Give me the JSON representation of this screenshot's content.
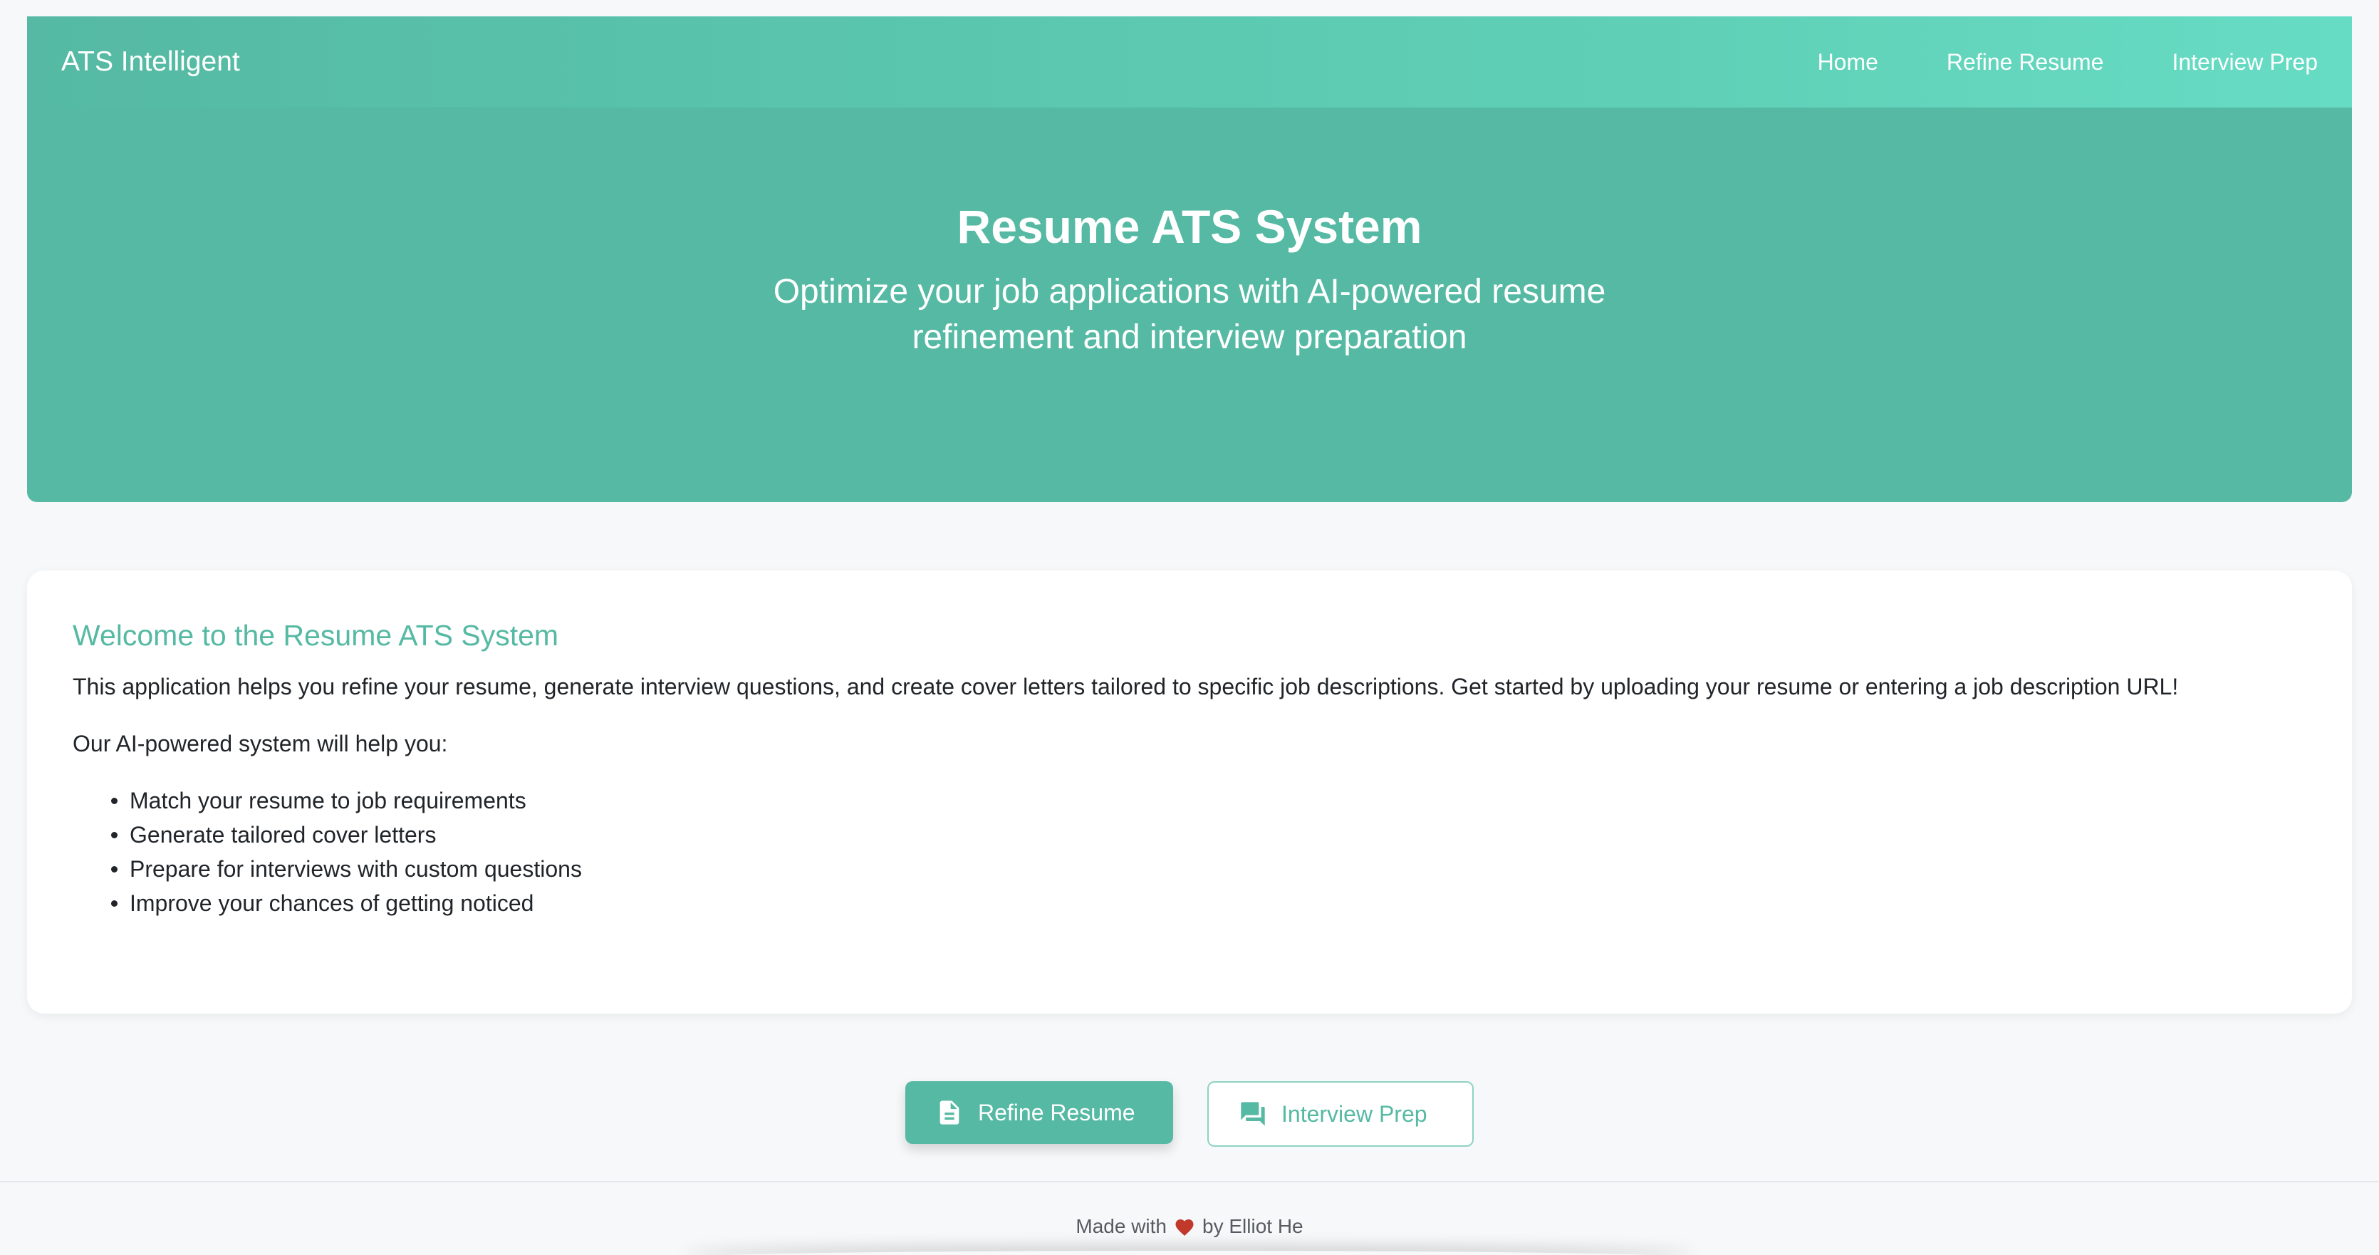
{
  "navbar": {
    "brand": "ATS Intelligent",
    "links": [
      {
        "label": "Home"
      },
      {
        "label": "Refine Resume"
      },
      {
        "label": "Interview Prep"
      }
    ]
  },
  "hero": {
    "title": "Resume ATS System",
    "subtitle": "Optimize your job applications with AI-powered resume refinement and interview preparation"
  },
  "welcome": {
    "title": "Welcome to the Resume ATS System",
    "intro": "This application helps you refine your resume, generate interview questions, and create cover letters tailored to specific job descriptions. Get started by uploading your resume or entering a job description URL!",
    "lead": "Our AI-powered system will help you:",
    "items": [
      "Match your resume to job requirements",
      "Generate tailored cover letters",
      "Prepare for interviews with custom questions",
      "Improve your chances of getting noticed"
    ]
  },
  "actions": {
    "refine_label": "Refine Resume",
    "refine_icon": "document-icon",
    "interview_label": "Interview Prep",
    "interview_icon": "chat-icon"
  },
  "footer": {
    "prefix": "Made with",
    "heart_icon": "heart-icon",
    "suffix": "by Elliot He"
  },
  "colors": {
    "accent": "#55b9a3",
    "accent_light": "#67dcc4",
    "heart": "#c0392b"
  }
}
